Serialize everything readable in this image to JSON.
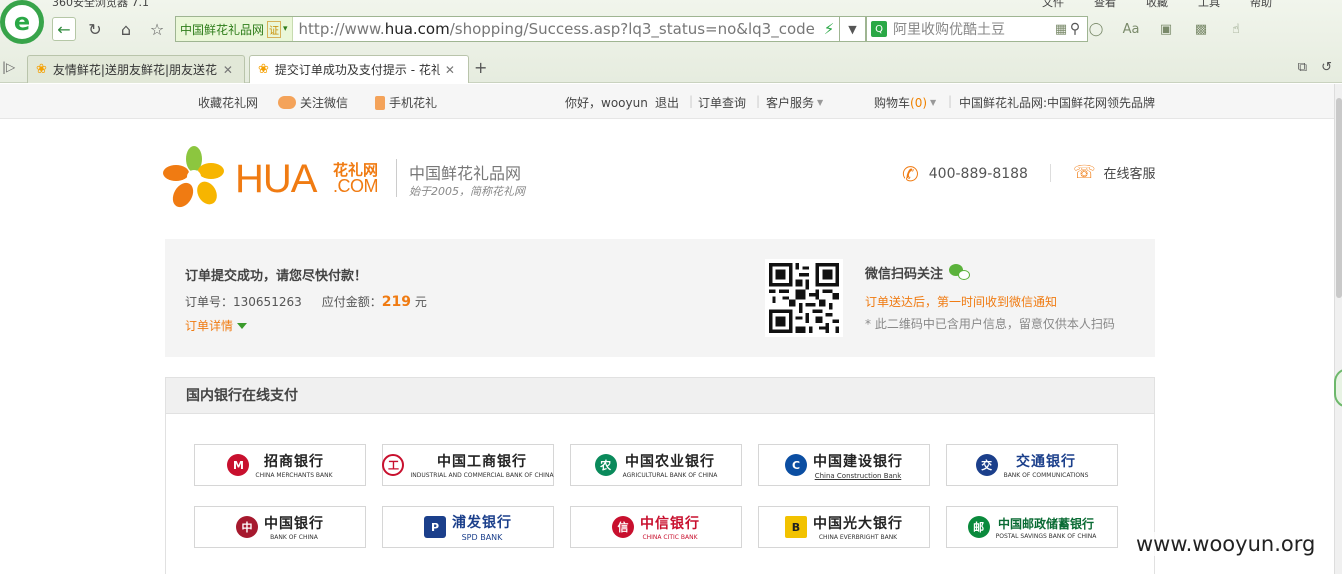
{
  "browser": {
    "title": "360安全浏览器 7.1",
    "menu": [
      "文件",
      "查看",
      "收藏",
      "工具",
      "帮助"
    ],
    "site_badge": "中国鲜花礼品网",
    "cert_label": "证",
    "url_prefix": "http://www.",
    "url_domain": "hua.com",
    "url_suffix": "/shopping/Success.asp?lq3_status=no&lq3_code",
    "search_placeholder": "阿里收购优酷土豆",
    "tabs": [
      {
        "label": "友情鲜花|送朋友鲜花|朋友送花"
      },
      {
        "label": "提交订单成功及支付提示 - 花礼网"
      }
    ]
  },
  "topbar": {
    "favorite": "收藏花礼网",
    "wechat": "关注微信",
    "mobile": "手机花礼",
    "greeting": "你好，wooyun",
    "logout": "退出",
    "order_query": "订单查询",
    "customer_service": "客户服务",
    "cart_label": "购物车",
    "cart_count": "(0)",
    "brand_slogan": "中国鲜花礼品网:中国鲜花网领先品牌"
  },
  "header": {
    "logo_main": "HUA",
    "logo_cn": "花礼网",
    "logo_com": ".COM",
    "slogan": "中国鲜花礼品网",
    "sub_slogan": "始于2005，简称花礼网",
    "hotline": "400-889-8188",
    "online_service": "在线客服"
  },
  "order": {
    "title": "订单提交成功，请您尽快付款！",
    "order_no_label": "订单号：",
    "order_no": "130651263",
    "amount_label": "应付金额：",
    "amount": "219",
    "currency": "元",
    "details_link": "订单详情",
    "wechat_title": "微信扫码关注",
    "wechat_line1": "订单送达后，第一时间收到微信通知",
    "wechat_line2": "* 此二维码中已含用户信息，留意仅供本人扫码"
  },
  "banks": {
    "section_title": "国内银行在线支付",
    "items": [
      {
        "cn": "招商银行",
        "en": "CHINA MERCHANTS BANK",
        "icon": "cmb-logo",
        "color": "#c8102e"
      },
      {
        "cn": "中国工商银行",
        "en": "INDUSTRIAL AND COMMERCIAL BANK OF CHINA",
        "icon": "icbc-logo",
        "color": "#c8102e"
      },
      {
        "cn": "中国农业银行",
        "en": "AGRICULTURAL BANK OF CHINA",
        "icon": "abc-logo",
        "color": "#0a8a5b"
      },
      {
        "cn": "中国建设银行",
        "en": "China Construction Bank",
        "icon": "ccb-logo",
        "color": "#0b4ea2"
      },
      {
        "cn": "交通银行",
        "en": "BANK OF COMMUNICATIONS",
        "icon": "bocom-logo",
        "color": "#1b3f8b"
      },
      {
        "cn": "中国银行",
        "en": "BANK OF CHINA",
        "icon": "boc-logo",
        "color": "#a6192e"
      },
      {
        "cn": "浦发银行",
        "en": "SPD BANK",
        "icon": "spdb-logo",
        "color": "#1b3f8b"
      },
      {
        "cn": "中信银行",
        "en": "CHINA CITIC BANK",
        "icon": "citic-logo",
        "color": "#c8102e"
      },
      {
        "cn": "中国光大银行",
        "en": "CHINA EVERBRIGHT BANK",
        "icon": "ceb-logo",
        "color": "#f2c200"
      },
      {
        "cn": "中国邮政储蓄银行",
        "en": "POSTAL SAVINGS BANK OF CHINA",
        "icon": "psbc-logo",
        "color": "#0a8a3c"
      }
    ]
  },
  "watermark": "www.wooyun.org"
}
